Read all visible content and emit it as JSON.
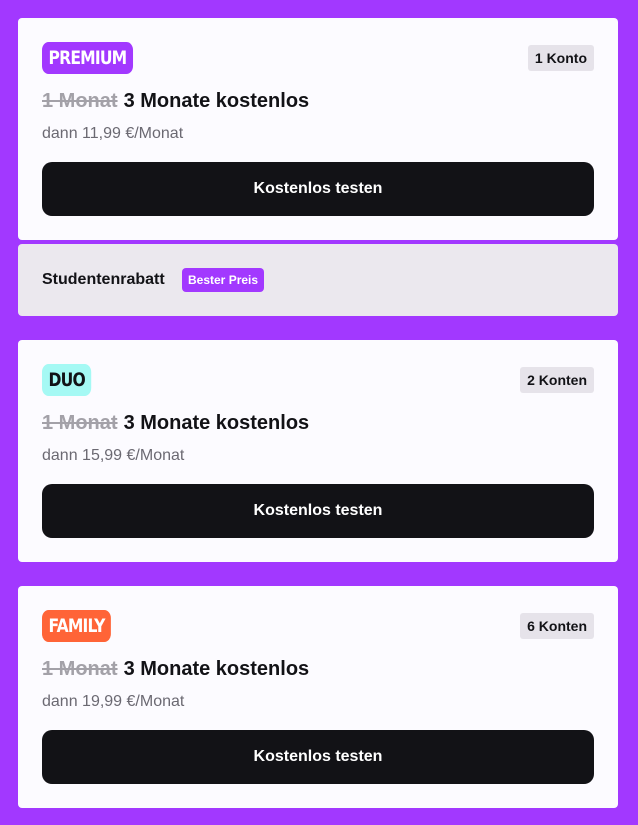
{
  "plans": [
    {
      "badge": "PREMIUM",
      "accounts": "1 Konto",
      "old_period": "1 Monat",
      "offer": "3 Monate kostenlos",
      "price": "dann 11,99 €/Monat",
      "cta": "Kostenlos testen"
    },
    {
      "badge": "DUO",
      "accounts": "2 Konten",
      "old_period": "1 Monat",
      "offer": "3 Monate kostenlos",
      "price": "dann 15,99 €/Monat",
      "cta": "Kostenlos testen"
    },
    {
      "badge": "FAMILY",
      "accounts": "6 Konten",
      "old_period": "1 Monat",
      "offer": "3 Monate kostenlos",
      "price": "dann 19,99 €/Monat",
      "cta": "Kostenlos testen"
    }
  ],
  "student": {
    "label": "Studentenrabatt",
    "badge": "Bester Preis"
  },
  "colors": {
    "background": "#a238ff",
    "premium": "#a238ff",
    "duo": "#a5f9f4",
    "family": "#ff6437",
    "cta": "#121216"
  }
}
